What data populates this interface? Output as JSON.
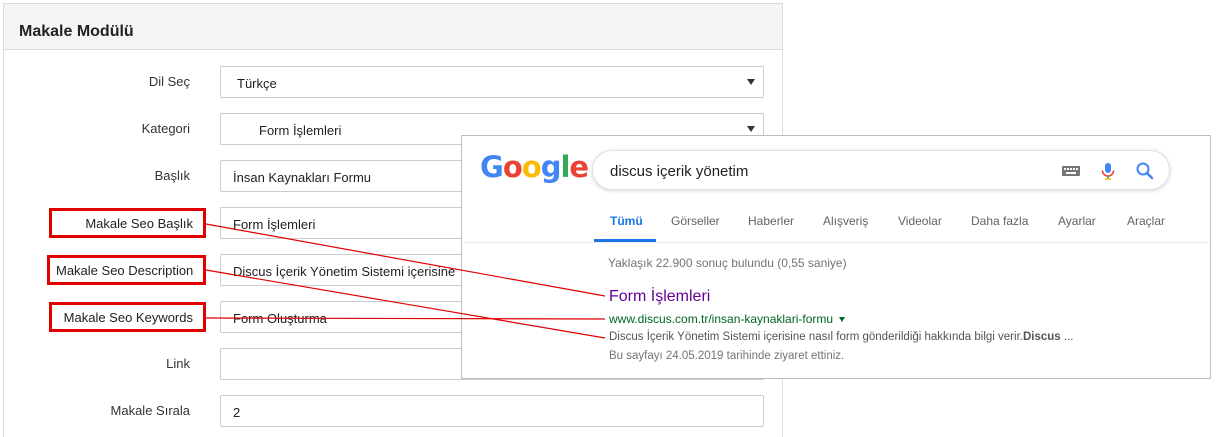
{
  "panel": {
    "title": "Makale Modülü",
    "fields": {
      "language": {
        "label": "Dil Seç",
        "value": "Türkçe"
      },
      "category": {
        "label": "Kategori",
        "value": "Form İşlemleri"
      },
      "title": {
        "label": "Başlık",
        "value": "İnsan Kaynakları Formu"
      },
      "seo_title": {
        "label": "Makale Seo Başlık",
        "value": "Form İşlemleri"
      },
      "seo_description": {
        "label": "Makale Seo Description",
        "value": "Discus İçerik Yönetim Sistemi içerisine"
      },
      "seo_keywords": {
        "label": "Makale Seo Keywords",
        "value": "Form Oluşturma"
      },
      "link": {
        "label": "Link",
        "value": ""
      },
      "order": {
        "label": "Makale Sırala",
        "value": "2"
      }
    }
  },
  "google": {
    "logo": [
      "G",
      "o",
      "o",
      "g",
      "l",
      "e"
    ],
    "logo_colors": [
      "#4285F4",
      "#EA4335",
      "#FBBC05",
      "#4285F4",
      "#34A853",
      "#EA4335"
    ],
    "query": "discus içerik yönetim",
    "icons": [
      "keyboard-icon",
      "microphone-icon",
      "search-icon"
    ],
    "tabs": [
      "Tümü",
      "Görseller",
      "Haberler",
      "Alışveriş",
      "Videolar",
      "Daha fazla",
      "Ayarlar",
      "Araçlar"
    ],
    "stats": "Yaklaşık 22.900 sonuç bulundu (0,55 saniye)",
    "result": {
      "title": "Form İşlemleri",
      "url": "www.discus.com.tr/insan-kaynaklari-formu",
      "snippet": "Discus İçerik Yönetim Sistemi içerisine nasıl form gönderildiği hakkında bilgi verir.",
      "snippet_bold": "Discus",
      "snippet_tail": " ...",
      "visited": "Bu sayfayı 24.05.2019 tarihinde ziyaret ettiniz."
    }
  },
  "colors": {
    "highlight_red": "#e00000",
    "google_blue": "#1a73e8",
    "visited_purple": "#660099",
    "url_green": "#006621"
  }
}
